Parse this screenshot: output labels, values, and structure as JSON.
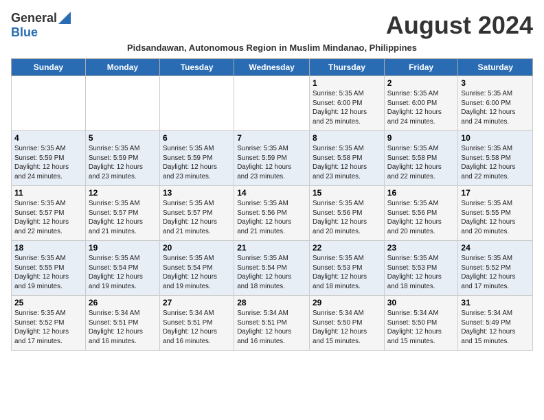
{
  "logo": {
    "general": "General",
    "blue": "Blue"
  },
  "title": "August 2024",
  "subtitle": "Pidsandawan, Autonomous Region in Muslim Mindanao, Philippines",
  "days_of_week": [
    "Sunday",
    "Monday",
    "Tuesday",
    "Wednesday",
    "Thursday",
    "Friday",
    "Saturday"
  ],
  "weeks": [
    [
      {
        "day": "",
        "info": ""
      },
      {
        "day": "",
        "info": ""
      },
      {
        "day": "",
        "info": ""
      },
      {
        "day": "",
        "info": ""
      },
      {
        "day": "1",
        "info": "Sunrise: 5:35 AM\nSunset: 6:00 PM\nDaylight: 12 hours\nand 25 minutes."
      },
      {
        "day": "2",
        "info": "Sunrise: 5:35 AM\nSunset: 6:00 PM\nDaylight: 12 hours\nand 24 minutes."
      },
      {
        "day": "3",
        "info": "Sunrise: 5:35 AM\nSunset: 6:00 PM\nDaylight: 12 hours\nand 24 minutes."
      }
    ],
    [
      {
        "day": "4",
        "info": "Sunrise: 5:35 AM\nSunset: 5:59 PM\nDaylight: 12 hours\nand 24 minutes."
      },
      {
        "day": "5",
        "info": "Sunrise: 5:35 AM\nSunset: 5:59 PM\nDaylight: 12 hours\nand 23 minutes."
      },
      {
        "day": "6",
        "info": "Sunrise: 5:35 AM\nSunset: 5:59 PM\nDaylight: 12 hours\nand 23 minutes."
      },
      {
        "day": "7",
        "info": "Sunrise: 5:35 AM\nSunset: 5:59 PM\nDaylight: 12 hours\nand 23 minutes."
      },
      {
        "day": "8",
        "info": "Sunrise: 5:35 AM\nSunset: 5:58 PM\nDaylight: 12 hours\nand 23 minutes."
      },
      {
        "day": "9",
        "info": "Sunrise: 5:35 AM\nSunset: 5:58 PM\nDaylight: 12 hours\nand 22 minutes."
      },
      {
        "day": "10",
        "info": "Sunrise: 5:35 AM\nSunset: 5:58 PM\nDaylight: 12 hours\nand 22 minutes."
      }
    ],
    [
      {
        "day": "11",
        "info": "Sunrise: 5:35 AM\nSunset: 5:57 PM\nDaylight: 12 hours\nand 22 minutes."
      },
      {
        "day": "12",
        "info": "Sunrise: 5:35 AM\nSunset: 5:57 PM\nDaylight: 12 hours\nand 21 minutes."
      },
      {
        "day": "13",
        "info": "Sunrise: 5:35 AM\nSunset: 5:57 PM\nDaylight: 12 hours\nand 21 minutes."
      },
      {
        "day": "14",
        "info": "Sunrise: 5:35 AM\nSunset: 5:56 PM\nDaylight: 12 hours\nand 21 minutes."
      },
      {
        "day": "15",
        "info": "Sunrise: 5:35 AM\nSunset: 5:56 PM\nDaylight: 12 hours\nand 20 minutes."
      },
      {
        "day": "16",
        "info": "Sunrise: 5:35 AM\nSunset: 5:56 PM\nDaylight: 12 hours\nand 20 minutes."
      },
      {
        "day": "17",
        "info": "Sunrise: 5:35 AM\nSunset: 5:55 PM\nDaylight: 12 hours\nand 20 minutes."
      }
    ],
    [
      {
        "day": "18",
        "info": "Sunrise: 5:35 AM\nSunset: 5:55 PM\nDaylight: 12 hours\nand 19 minutes."
      },
      {
        "day": "19",
        "info": "Sunrise: 5:35 AM\nSunset: 5:54 PM\nDaylight: 12 hours\nand 19 minutes."
      },
      {
        "day": "20",
        "info": "Sunrise: 5:35 AM\nSunset: 5:54 PM\nDaylight: 12 hours\nand 19 minutes."
      },
      {
        "day": "21",
        "info": "Sunrise: 5:35 AM\nSunset: 5:54 PM\nDaylight: 12 hours\nand 18 minutes."
      },
      {
        "day": "22",
        "info": "Sunrise: 5:35 AM\nSunset: 5:53 PM\nDaylight: 12 hours\nand 18 minutes."
      },
      {
        "day": "23",
        "info": "Sunrise: 5:35 AM\nSunset: 5:53 PM\nDaylight: 12 hours\nand 18 minutes."
      },
      {
        "day": "24",
        "info": "Sunrise: 5:35 AM\nSunset: 5:52 PM\nDaylight: 12 hours\nand 17 minutes."
      }
    ],
    [
      {
        "day": "25",
        "info": "Sunrise: 5:35 AM\nSunset: 5:52 PM\nDaylight: 12 hours\nand 17 minutes."
      },
      {
        "day": "26",
        "info": "Sunrise: 5:34 AM\nSunset: 5:51 PM\nDaylight: 12 hours\nand 16 minutes."
      },
      {
        "day": "27",
        "info": "Sunrise: 5:34 AM\nSunset: 5:51 PM\nDaylight: 12 hours\nand 16 minutes."
      },
      {
        "day": "28",
        "info": "Sunrise: 5:34 AM\nSunset: 5:51 PM\nDaylight: 12 hours\nand 16 minutes."
      },
      {
        "day": "29",
        "info": "Sunrise: 5:34 AM\nSunset: 5:50 PM\nDaylight: 12 hours\nand 15 minutes."
      },
      {
        "day": "30",
        "info": "Sunrise: 5:34 AM\nSunset: 5:50 PM\nDaylight: 12 hours\nand 15 minutes."
      },
      {
        "day": "31",
        "info": "Sunrise: 5:34 AM\nSunset: 5:49 PM\nDaylight: 12 hours\nand 15 minutes."
      }
    ]
  ]
}
